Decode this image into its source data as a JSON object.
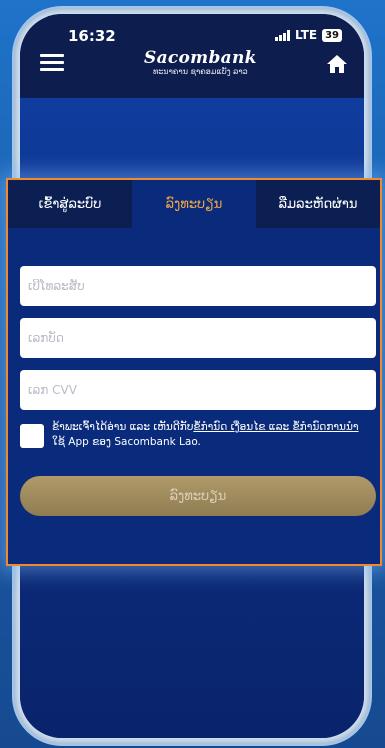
{
  "status": {
    "time": "16:32",
    "network": "LTE",
    "battery": "39"
  },
  "header": {
    "brand": "Sacombank",
    "brand_sub": "ທະນາຄານ ຊາຄອມແບັງ ລາວ"
  },
  "tabs": [
    {
      "label": "ເຂົ້າສູ່ລະບົບ",
      "active": false
    },
    {
      "label": "ລົງທະບຽນ",
      "active": true
    },
    {
      "label": "ລືມລະຫັດຜ່ານ",
      "active": false
    }
  ],
  "form": {
    "phone_placeholder": "ເບີໂທລະສັບ",
    "card_placeholder": "ເລກບັດ",
    "cvv_placeholder": "ເລກ CVV"
  },
  "terms": {
    "prefix": "ຂ້າພະເຈົ້າໄດ້ອ່ານ ແລະ ເຫັນດີກັບ",
    "link": "ຂໍ້ກໍານົດ ເງື່ອນໄຂ ແລະ ຂໍ້ກໍານົດການນໍາ",
    "suffix": "ໃຊ້ App ຂອງ Sacombank Lao."
  },
  "register_button": "ລົງທະບຽນ"
}
